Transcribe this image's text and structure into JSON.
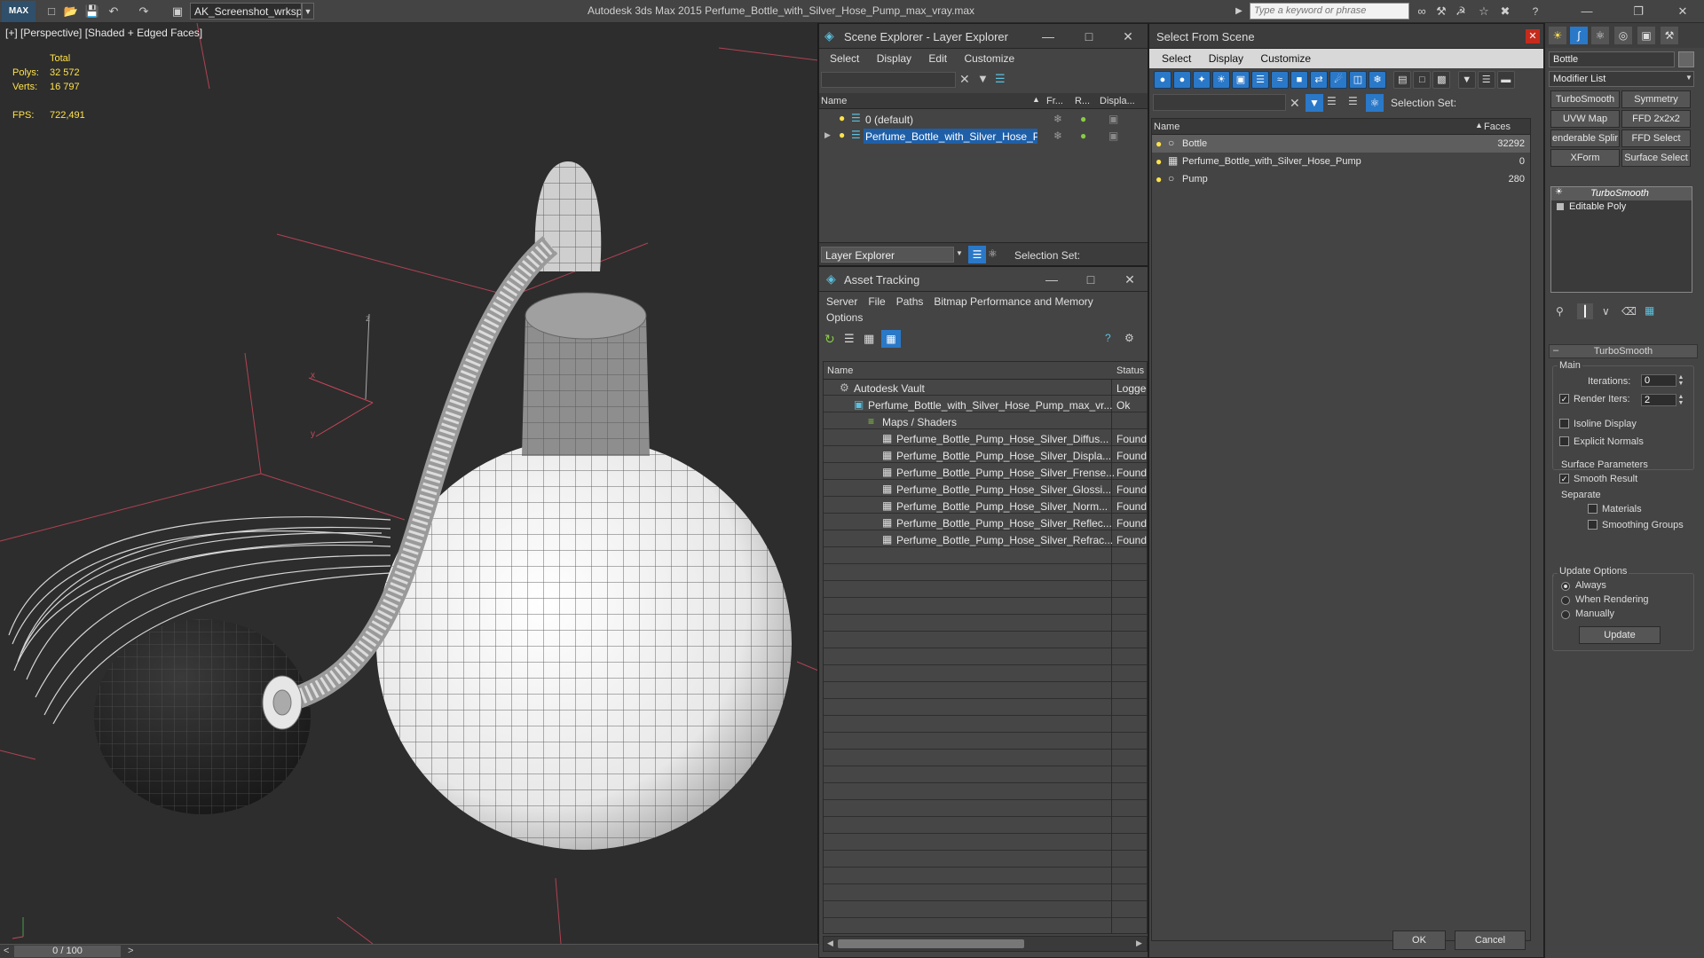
{
  "titlebar": {
    "logo": "MAX",
    "workspace": "AK_Screenshot_wrksp",
    "app_title": "Autodesk 3ds Max  2015     Perfume_Bottle_with_Silver_Hose_Pump_max_vray.max",
    "search_placeholder": "Type a keyword or phrase"
  },
  "viewport": {
    "label": "[+] [Perspective] [Shaded + Edged Faces]",
    "stats": {
      "total_label": "Total",
      "polys_label": "Polys:",
      "polys": "32 572",
      "verts_label": "Verts:",
      "verts": "16 797",
      "fps_label": "FPS:",
      "fps": "722,491"
    },
    "axis": {
      "x": "x",
      "y": "y",
      "z": "z"
    },
    "time_slider": "0 / 100",
    "prev": "<",
    "next": ">"
  },
  "scene_explorer": {
    "title": "Scene Explorer - Layer Explorer",
    "menu": [
      "Select",
      "Display",
      "Edit",
      "Customize"
    ],
    "columns": {
      "name": "Name",
      "frozen": "Fr...",
      "render": "R...",
      "display": "Displa..."
    },
    "rows": [
      {
        "name": "0 (default)",
        "selected": false
      },
      {
        "name": "Perfume_Bottle_with_Silver_Hose_Pu...",
        "selected": true
      }
    ],
    "footer_dropdown": "Layer Explorer",
    "selection_set_label": "Selection Set:"
  },
  "asset_tracking": {
    "title": "Asset Tracking",
    "menu": [
      "Server",
      "File",
      "Paths",
      "Bitmap Performance and Memory"
    ],
    "menu2": "Options",
    "columns": {
      "name": "Name",
      "status": "Status"
    },
    "rows": [
      {
        "name": "Autodesk Vault",
        "status": "Logged",
        "indent": 0,
        "icon": "vault-icon"
      },
      {
        "name": "Perfume_Bottle_with_Silver_Hose_Pump_max_vr...",
        "status": "Ok",
        "indent": 1,
        "icon": "max-file-icon"
      },
      {
        "name": "Maps / Shaders",
        "status": "",
        "indent": 2,
        "icon": "maps-icon"
      },
      {
        "name": "Perfume_Bottle_Pump_Hose_Silver_Diffus...",
        "status": "Found",
        "indent": 3,
        "icon": "bitmap-icon"
      },
      {
        "name": "Perfume_Bottle_Pump_Hose_Silver_Displa...",
        "status": "Found",
        "indent": 3,
        "icon": "bitmap-icon"
      },
      {
        "name": "Perfume_Bottle_Pump_Hose_Silver_Frense...",
        "status": "Found",
        "indent": 3,
        "icon": "bitmap-icon"
      },
      {
        "name": "Perfume_Bottle_Pump_Hose_Silver_Glossi...",
        "status": "Found",
        "indent": 3,
        "icon": "bitmap-icon"
      },
      {
        "name": "Perfume_Bottle_Pump_Hose_Silver_Norm...",
        "status": "Found",
        "indent": 3,
        "icon": "bitmap-icon"
      },
      {
        "name": "Perfume_Bottle_Pump_Hose_Silver_Reflec...",
        "status": "Found",
        "indent": 3,
        "icon": "bitmap-icon"
      },
      {
        "name": "Perfume_Bottle_Pump_Hose_Silver_Refrac...",
        "status": "Found",
        "indent": 3,
        "icon": "bitmap-icon"
      }
    ]
  },
  "select_from_scene": {
    "title": "Select From Scene",
    "menu": [
      "Select",
      "Display",
      "Customize"
    ],
    "selection_set_label": "Selection Set:",
    "columns": {
      "name": "Name",
      "faces": "Faces"
    },
    "rows": [
      {
        "name": "Bottle",
        "faces": "32292",
        "selected": true
      },
      {
        "name": "Perfume_Bottle_with_Silver_Hose_Pump",
        "faces": "0",
        "selected": false
      },
      {
        "name": "Pump",
        "faces": "280",
        "selected": false
      }
    ],
    "ok": "OK",
    "cancel": "Cancel"
  },
  "command_panel": {
    "object_name": "Bottle",
    "modifier_list": "Modifier List",
    "buttons": [
      "TurboSmooth",
      "Symmetry",
      "UVW Map",
      "FFD 2x2x2",
      "enderable Splir",
      "FFD Select",
      "XForm",
      "Surface Select"
    ],
    "stack": [
      "TurboSmooth",
      "Editable Poly"
    ],
    "rollout_title": "TurboSmooth",
    "main_label": "Main",
    "iterations_label": "Iterations:",
    "iterations": "0",
    "render_iters_label": "Render Iters:",
    "render_iters": "2",
    "isoline_label": "Isoline Display",
    "explicit_label": "Explicit Normals",
    "surface_label": "Surface Parameters",
    "smooth_label": "Smooth Result",
    "separate_label": "Separate",
    "materials_label": "Materials",
    "smoothing_label": "Smoothing Groups",
    "update_options_label": "Update Options",
    "always_label": "Always",
    "when_rendering_label": "When Rendering",
    "manually_label": "Manually",
    "update_button": "Update"
  },
  "colors": {
    "accent": "#2a78c8",
    "stat_yellow": "#ffe24a",
    "selected_row": "#1e5fa8",
    "red_close": "#c42b1c"
  }
}
